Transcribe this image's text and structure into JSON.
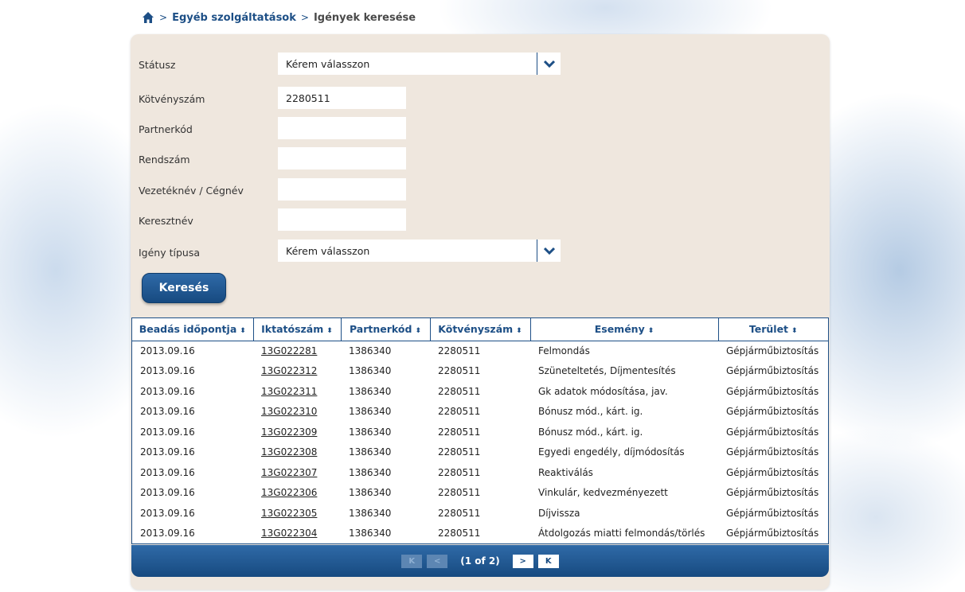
{
  "breadcrumb": {
    "items": [
      "Egyéb szolgáltatások",
      "Igények keresése"
    ]
  },
  "form": {
    "status_label": "Státusz",
    "status_value": "Kérem válasszon",
    "policy_label": "Kötvényszám",
    "policy_value": "2280511",
    "partner_label": "Partnerkód",
    "partner_value": "",
    "plate_label": "Rendszám",
    "plate_value": "",
    "lastname_label": "Vezetéknév / Cégnév",
    "lastname_value": "",
    "firstname_label": "Keresztnév",
    "firstname_value": "",
    "claimtype_label": "Igény típusa",
    "claimtype_value": "Kérem válasszon",
    "search_button": "Keresés"
  },
  "table": {
    "headers": [
      "Beadás időpontja",
      "Iktatószám",
      "Partnerkód",
      "Kötvényszám",
      "Esemény",
      "Terület"
    ],
    "rows": [
      [
        "2013.09.16",
        "13G022281",
        "1386340",
        "2280511",
        "Felmondás",
        "Gépjárműbiztosítás"
      ],
      [
        "2013.09.16",
        "13G022312",
        "1386340",
        "2280511",
        "Szüneteltetés, Díjmentesítés",
        "Gépjárműbiztosítás"
      ],
      [
        "2013.09.16",
        "13G022311",
        "1386340",
        "2280511",
        "Gk adatok módosítása, jav.",
        "Gépjárműbiztosítás"
      ],
      [
        "2013.09.16",
        "13G022310",
        "1386340",
        "2280511",
        "Bónusz mód., kárt. ig.",
        "Gépjárműbiztosítás"
      ],
      [
        "2013.09.16",
        "13G022309",
        "1386340",
        "2280511",
        "Bónusz mód., kárt. ig.",
        "Gépjárműbiztosítás"
      ],
      [
        "2013.09.16",
        "13G022308",
        "1386340",
        "2280511",
        "Egyedi engedély, díjmódosítás",
        "Gépjárműbiztosítás"
      ],
      [
        "2013.09.16",
        "13G022307",
        "1386340",
        "2280511",
        "Reaktiválás",
        "Gépjárműbiztosítás"
      ],
      [
        "2013.09.16",
        "13G022306",
        "1386340",
        "2280511",
        "Vinkulár, kedvezményezett",
        "Gépjárműbiztosítás"
      ],
      [
        "2013.09.16",
        "13G022305",
        "1386340",
        "2280511",
        "Díjvissza",
        "Gépjárműbiztosítás"
      ],
      [
        "2013.09.16",
        "13G022304",
        "1386340",
        "2280511",
        "Átdolgozás miatti felmondás/törlés",
        "Gépjárműbiztosítás"
      ]
    ]
  },
  "pager": {
    "info": "(1 of 2)",
    "first": "K",
    "prev": "<",
    "next": ">",
    "last": "K"
  },
  "colors": {
    "primary": "#1d4f86",
    "panel": "#efe7de"
  }
}
